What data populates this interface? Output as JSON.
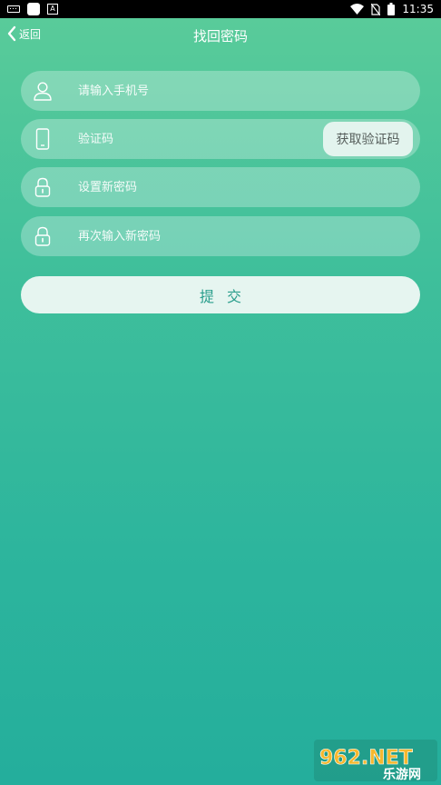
{
  "status_bar": {
    "time": "11:35",
    "icons": [
      "keyboard-icon",
      "app-square-icon",
      "a-icon",
      "wifi-icon",
      "no-sim-icon",
      "battery-icon"
    ]
  },
  "header": {
    "back_label": "返回",
    "title": "找回密码"
  },
  "form": {
    "phone": {
      "placeholder": "请输入手机号",
      "icon": "user-icon"
    },
    "code": {
      "placeholder": "验证码",
      "icon": "phone-icon",
      "button_label": "获取验证码"
    },
    "new_password": {
      "placeholder": "设置新密码",
      "icon": "lock-icon"
    },
    "confirm_password": {
      "placeholder": "再次输入新密码",
      "icon": "lock-icon"
    },
    "submit_label": "提交"
  },
  "watermark": {
    "main": "962.NET",
    "sub": "乐游网"
  },
  "colors": {
    "bg_top": "#5bcc9a",
    "bg_bottom": "#24ae9c",
    "button_text": "#2a9e8c",
    "code_button_bg": "#e3f4ee"
  }
}
